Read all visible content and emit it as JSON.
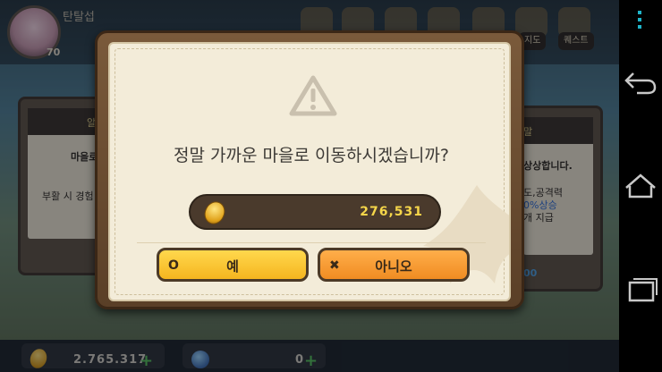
{
  "player": {
    "name": "탄탈섭",
    "level": "70"
  },
  "top_buttons": [
    "지도",
    "퀘스트"
  ],
  "left_panel": {
    "title": "알",
    "line1": "마을로",
    "line2": "부활 시 경험"
  },
  "right_panel": {
    "title": "말",
    "line1": "상상합니다.",
    "line2": "도,공격력",
    "line3": "0%상승",
    "line4": "개 지급",
    "line5": "00"
  },
  "dialog": {
    "message": "정말 가까운 마을로 이동하시겠습니까?",
    "gold_amount": "276,531",
    "yes_label": "예",
    "no_label": "아니오",
    "yes_icon": "O",
    "no_icon": "✖"
  },
  "bottom_bar": {
    "gold": "2.765.317",
    "candy": "0"
  },
  "icons": [
    "warning-icon",
    "gold-coin-icon",
    "candy-icon",
    "plus-icon",
    "menu-icon",
    "back-icon",
    "home-icon",
    "recent-apps-icon"
  ],
  "colors": {
    "yes_button": "#f5b51f",
    "no_button": "#f08c22",
    "gold_text": "#f5d64a",
    "nav_accent": "#1fb4c9"
  }
}
